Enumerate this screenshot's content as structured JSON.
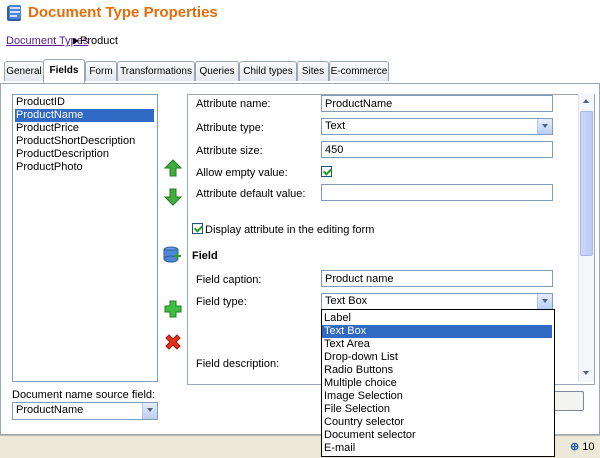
{
  "header": {
    "title": "Document Type Properties",
    "icon": "document-type-icon"
  },
  "breadcrumb": {
    "parent": "Document Types",
    "current": "Product"
  },
  "tabs": [
    {
      "label": "General"
    },
    {
      "label": "Fields"
    },
    {
      "label": "Form"
    },
    {
      "label": "Transformations"
    },
    {
      "label": "Queries"
    },
    {
      "label": "Child types"
    },
    {
      "label": "Sites"
    },
    {
      "label": "E-commerce"
    }
  ],
  "active_tab": "Fields",
  "fields": {
    "items": [
      "ProductID",
      "ProductName",
      "ProductPrice",
      "ProductShortDescription",
      "ProductDescription",
      "ProductPhoto"
    ],
    "selected": "ProductName"
  },
  "attribute": {
    "name_label": "Attribute name:",
    "name_value": "ProductName",
    "type_label": "Attribute type:",
    "type_value": "Text",
    "size_label": "Attribute size:",
    "size_value": "450",
    "allow_empty_label": "Allow empty value:",
    "allow_empty_checked": true,
    "default_label": "Attribute default value:",
    "default_value": "",
    "display_label": "Display attribute in the editing form",
    "display_checked": true
  },
  "field_section": {
    "heading": "Field",
    "caption_label": "Field caption:",
    "caption_value": "Product name",
    "type_label": "Field type:",
    "type_value": "Text Box",
    "description_label": "Field description:"
  },
  "field_type_options": [
    "Label",
    "Text Box",
    "Text Area",
    "Drop-down List",
    "Radio Buttons",
    "Multiple choice",
    "Image Selection",
    "File Selection",
    "Country selector",
    "Document selector",
    "E-mail"
  ],
  "field_type_highlighted": "Text Box",
  "document_name_source": {
    "label": "Document name source field:",
    "value": "ProductName"
  },
  "status": {
    "zoom": "10"
  },
  "colors": {
    "title": "#e46c0a",
    "selection": "#316ac5",
    "link": "#551a8b"
  }
}
